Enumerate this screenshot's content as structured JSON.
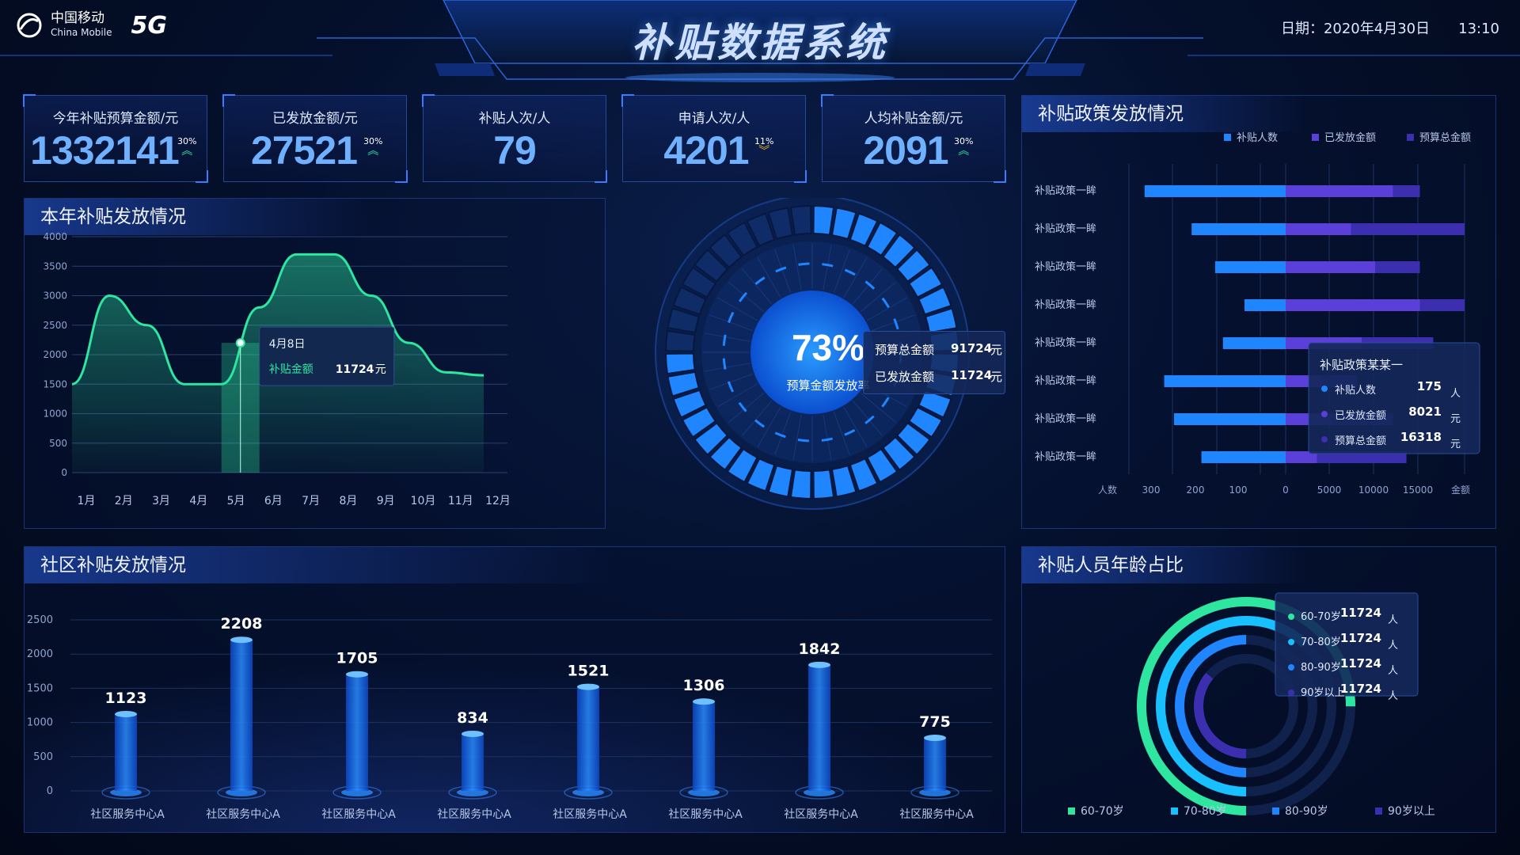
{
  "header": {
    "logo_cn": "中国移动",
    "logo_en": "China Mobile",
    "logo_5g": "5G",
    "title": "补贴数据系统",
    "date_label": "日期：2020年4月30日",
    "time": "13:10"
  },
  "kpis": [
    {
      "label": "今年补贴预算金额/元",
      "value": "1332141",
      "pct": "30%",
      "dir": "up"
    },
    {
      "label": "已发放金额/元",
      "value": "27521",
      "pct": "30%",
      "dir": "up"
    },
    {
      "label": "补贴人次/人",
      "value": "79",
      "pct": "",
      "dir": ""
    },
    {
      "label": "申请人次/人",
      "value": "4201",
      "pct": "11%",
      "dir": "down"
    },
    {
      "label": "人均补贴金额/元",
      "value": "2091",
      "pct": "30%",
      "dir": "up"
    }
  ],
  "panels": {
    "yearly": "本年补贴发放情况",
    "policy": "补贴政策发放情况",
    "community": "社区补贴发放情况",
    "age": "补贴人员年龄占比"
  },
  "colors": {
    "green": "#2ee6a0",
    "blue": "#1f86ff",
    "cyan": "#19c0ff",
    "purple": "#5a3fd8",
    "deep": "#3b2fb0",
    "gold": "#f0b020"
  },
  "gauge": {
    "pct": "73%",
    "caption": "预算金额发放率",
    "fraction": 0.73,
    "budget_label": "预算总金额",
    "budget_value": "91724",
    "paid_label": "已发放金额",
    "paid_value": "11724",
    "unit": "元"
  },
  "chart_data": [
    {
      "type": "area",
      "title": "本年补贴发放情况",
      "categories": [
        "1月",
        "2月",
        "3月",
        "4月",
        "5月",
        "6月",
        "7月",
        "8月",
        "9月",
        "10月",
        "11月",
        "12月"
      ],
      "values": [
        1500,
        3000,
        2500,
        1500,
        1500,
        2800,
        3700,
        3700,
        3000,
        2200,
        1700,
        1650
      ],
      "yticks": [
        0,
        500,
        1000,
        1500,
        2000,
        2500,
        3000,
        3500,
        4000
      ],
      "ylim": [
        0,
        4000
      ],
      "tooltip": {
        "date": "4月8日",
        "label": "补贴金额",
        "value": "11724",
        "unit": "元"
      }
    },
    {
      "type": "bar",
      "title": "补贴政策发放情况",
      "legend": [
        "补贴人数",
        "已发放金额",
        "预算总金额"
      ],
      "categories": [
        "补贴政策一眸",
        "补贴政策一眸",
        "补贴政策一眸",
        "补贴政策一眸",
        "补贴政策一眸",
        "补贴政策一眸",
        "补贴政策一眸",
        "补贴政策一眸"
      ],
      "people": [
        360,
        240,
        180,
        105,
        160,
        310,
        285,
        215
      ],
      "paid": [
        12000,
        7300,
        10000,
        15000,
        8500,
        4000,
        5000,
        3500
      ],
      "budget": [
        15000,
        20000,
        15000,
        20000,
        16500,
        8000,
        12000,
        13500
      ],
      "left_ticks": [
        "人数",
        "300",
        "200",
        "100",
        "0"
      ],
      "right_ticks": [
        "5000",
        "10000",
        "15000",
        "金额"
      ],
      "tooltip": {
        "title": "补贴政策某某一",
        "rows": [
          {
            "label": "补贴人数",
            "value": "175",
            "unit": "人"
          },
          {
            "label": "已发放金额",
            "value": "8021",
            "unit": "元"
          },
          {
            "label": "预算总金额",
            "value": "16318",
            "unit": "元"
          }
        ]
      }
    },
    {
      "type": "bar",
      "title": "社区补贴发放情况",
      "categories": [
        "社区服务中心A",
        "社区服务中心A",
        "社区服务中心A",
        "社区服务中心A",
        "社区服务中心A",
        "社区服务中心A",
        "社区服务中心A",
        "社区服务中心A"
      ],
      "values": [
        1123,
        2208,
        1705,
        834,
        1521,
        1306,
        1842,
        775
      ],
      "yticks": [
        0,
        500,
        1000,
        1500,
        2000,
        2500
      ],
      "ylim": [
        0,
        2500
      ]
    },
    {
      "type": "pie",
      "title": "补贴人员年龄占比",
      "categories": [
        "60-70岁",
        "70-80岁",
        "80-90岁",
        "90岁以上"
      ],
      "values": [
        11724,
        11724,
        11724,
        11724
      ],
      "arc_fractions": [
        0.75,
        0.62,
        0.5,
        0.36
      ],
      "unit": "人"
    }
  ]
}
